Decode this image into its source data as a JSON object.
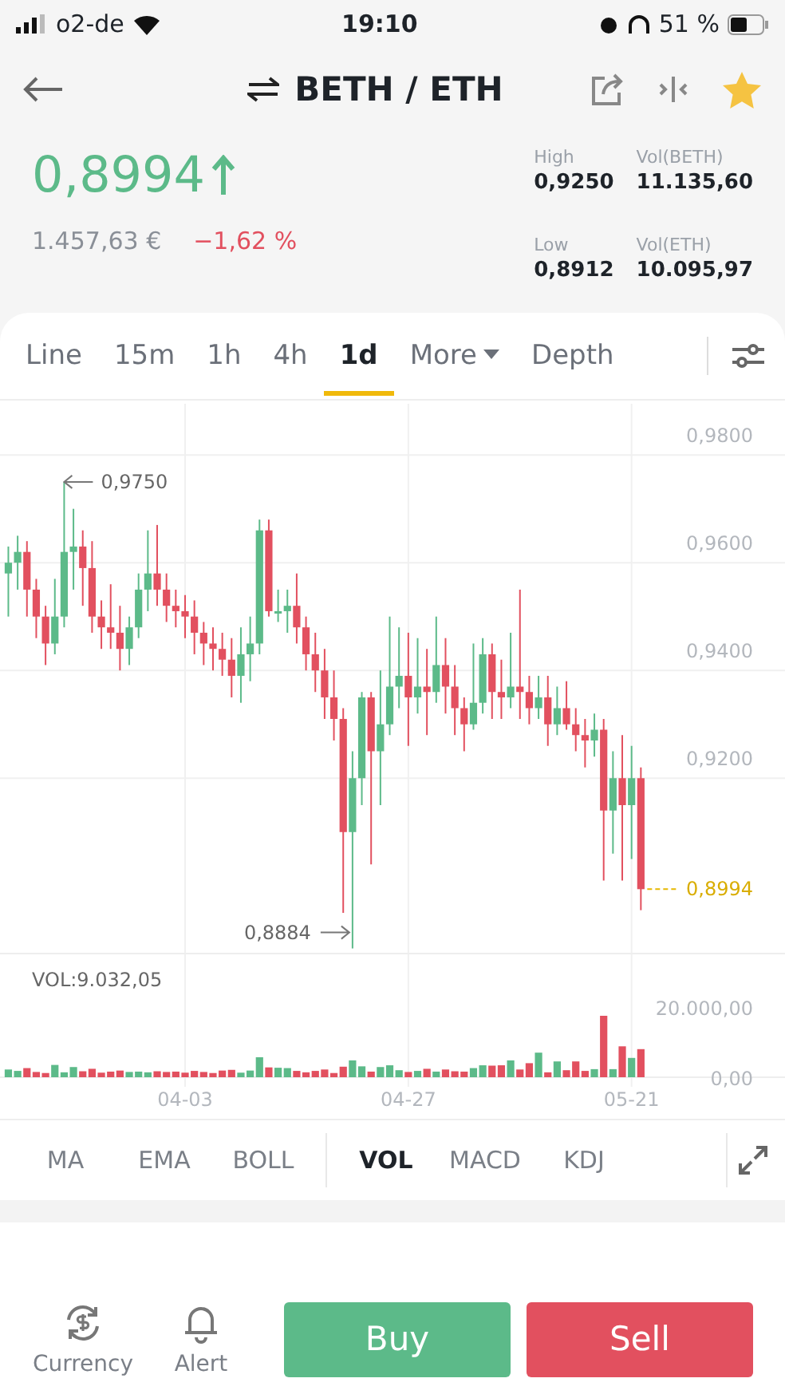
{
  "status_bar": {
    "carrier": "o2-de",
    "time": "19:10",
    "battery": "51 %"
  },
  "header": {
    "title": "BETH / ETH"
  },
  "ticker": {
    "price": "0,8994",
    "fiat_price": "1.457,63 €",
    "change": "−1,62 %",
    "stats": [
      {
        "label": "High",
        "value": "0,9250"
      },
      {
        "label": "Vol(BETH)",
        "value": "11.135,60"
      },
      {
        "label": "Low",
        "value": "0,8912"
      },
      {
        "label": "Vol(ETH)",
        "value": "10.095,97"
      }
    ]
  },
  "tabs": [
    {
      "label": "Line",
      "kind": "tab",
      "selected": false
    },
    {
      "label": "15m",
      "kind": "tab",
      "selected": false
    },
    {
      "label": "1h",
      "kind": "tab",
      "selected": false
    },
    {
      "label": "4h",
      "kind": "tab",
      "selected": false
    },
    {
      "label": "1d",
      "kind": "tab",
      "selected": true
    },
    {
      "label": "More",
      "kind": "menu",
      "selected": false
    },
    {
      "label": "Depth",
      "kind": "tab",
      "selected": false
    }
  ],
  "price_chart": {
    "high_mark": "0,9750",
    "low_mark": "0,8884",
    "last_price": "0,8994",
    "chart_data": {
      "type": "candlestick",
      "grid": true,
      "ohlc": [
        [
          0.958,
          0.963,
          0.95,
          0.96
        ],
        [
          0.96,
          0.965,
          0.955,
          0.962
        ],
        [
          0.962,
          0.964,
          0.95,
          0.955
        ],
        [
          0.955,
          0.957,
          0.946,
          0.95
        ],
        [
          0.95,
          0.952,
          0.941,
          0.945
        ],
        [
          0.945,
          0.957,
          0.943,
          0.95
        ],
        [
          0.95,
          0.975,
          0.948,
          0.962
        ],
        [
          0.962,
          0.97,
          0.955,
          0.963
        ],
        [
          0.963,
          0.966,
          0.952,
          0.959
        ],
        [
          0.959,
          0.964,
          0.947,
          0.95
        ],
        [
          0.95,
          0.953,
          0.944,
          0.948
        ],
        [
          0.948,
          0.956,
          0.944,
          0.947
        ],
        [
          0.947,
          0.952,
          0.94,
          0.944
        ],
        [
          0.944,
          0.95,
          0.941,
          0.948
        ],
        [
          0.948,
          0.958,
          0.946,
          0.955
        ],
        [
          0.955,
          0.966,
          0.951,
          0.958
        ],
        [
          0.958,
          0.967,
          0.952,
          0.955
        ],
        [
          0.955,
          0.958,
          0.949,
          0.952
        ],
        [
          0.952,
          0.955,
          0.948,
          0.951
        ],
        [
          0.951,
          0.954,
          0.946,
          0.95
        ],
        [
          0.95,
          0.953,
          0.943,
          0.947
        ],
        [
          0.947,
          0.949,
          0.941,
          0.945
        ],
        [
          0.945,
          0.948,
          0.94,
          0.944
        ],
        [
          0.944,
          0.947,
          0.939,
          0.942
        ],
        [
          0.942,
          0.946,
          0.935,
          0.939
        ],
        [
          0.939,
          0.948,
          0.934,
          0.943
        ],
        [
          0.943,
          0.95,
          0.938,
          0.945
        ],
        [
          0.945,
          0.968,
          0.943,
          0.966
        ],
        [
          0.966,
          0.968,
          0.95,
          0.951
        ],
        [
          0.951,
          0.955,
          0.949,
          0.951
        ],
        [
          0.951,
          0.955,
          0.947,
          0.952
        ],
        [
          0.952,
          0.958,
          0.945,
          0.948
        ],
        [
          0.948,
          0.95,
          0.94,
          0.943
        ],
        [
          0.943,
          0.947,
          0.936,
          0.94
        ],
        [
          0.94,
          0.944,
          0.931,
          0.935
        ],
        [
          0.935,
          0.94,
          0.927,
          0.931
        ],
        [
          0.931,
          0.933,
          0.895,
          0.91
        ],
        [
          0.91,
          0.925,
          0.8884,
          0.92
        ],
        [
          0.92,
          0.936,
          0.915,
          0.935
        ],
        [
          0.935,
          0.936,
          0.904,
          0.925
        ],
        [
          0.925,
          0.94,
          0.915,
          0.93
        ],
        [
          0.93,
          0.95,
          0.928,
          0.937
        ],
        [
          0.937,
          0.948,
          0.933,
          0.939
        ],
        [
          0.939,
          0.947,
          0.926,
          0.935
        ],
        [
          0.935,
          0.946,
          0.932,
          0.937
        ],
        [
          0.937,
          0.944,
          0.928,
          0.936
        ],
        [
          0.936,
          0.95,
          0.934,
          0.941
        ],
        [
          0.941,
          0.946,
          0.932,
          0.937
        ],
        [
          0.937,
          0.941,
          0.928,
          0.933
        ],
        [
          0.933,
          0.935,
          0.925,
          0.93
        ],
        [
          0.93,
          0.945,
          0.929,
          0.934
        ],
        [
          0.934,
          0.946,
          0.932,
          0.943
        ],
        [
          0.943,
          0.945,
          0.931,
          0.936
        ],
        [
          0.936,
          0.942,
          0.931,
          0.935
        ],
        [
          0.935,
          0.947,
          0.933,
          0.937
        ],
        [
          0.937,
          0.955,
          0.931,
          0.936
        ],
        [
          0.936,
          0.939,
          0.93,
          0.933
        ],
        [
          0.933,
          0.939,
          0.931,
          0.935
        ],
        [
          0.935,
          0.939,
          0.926,
          0.93
        ],
        [
          0.93,
          0.937,
          0.928,
          0.933
        ],
        [
          0.933,
          0.938,
          0.929,
          0.93
        ],
        [
          0.93,
          0.933,
          0.925,
          0.928
        ],
        [
          0.928,
          0.931,
          0.922,
          0.927
        ],
        [
          0.927,
          0.932,
          0.924,
          0.929
        ],
        [
          0.929,
          0.931,
          0.901,
          0.914
        ],
        [
          0.914,
          0.925,
          0.906,
          0.92
        ],
        [
          0.92,
          0.928,
          0.901,
          0.915
        ],
        [
          0.915,
          0.926,
          0.905,
          0.92
        ],
        [
          0.92,
          0.922,
          0.8955,
          0.8994
        ]
      ],
      "ylim": [
        0.8876,
        0.9895
      ],
      "yticks": [
        {
          "value": 0.98,
          "label": "0,9800"
        },
        {
          "value": 0.96,
          "label": "0,9600"
        },
        {
          "value": 0.94,
          "label": "0,9400"
        },
        {
          "value": 0.92,
          "label": "0,9200"
        }
      ]
    }
  },
  "volume_chart": {
    "chart_data": {
      "type": "bar",
      "title": "VOL:9.032,05",
      "grid": true,
      "categories": [
        null,
        null,
        null,
        null,
        null,
        null,
        null,
        null,
        null,
        null,
        null,
        null,
        null,
        null,
        null,
        null,
        null,
        null,
        null,
        "04-03",
        null,
        null,
        null,
        null,
        null,
        null,
        null,
        null,
        null,
        null,
        null,
        null,
        null,
        null,
        null,
        null,
        null,
        null,
        null,
        null,
        null,
        null,
        null,
        "04-27",
        null,
        null,
        null,
        null,
        null,
        null,
        null,
        null,
        null,
        null,
        null,
        null,
        null,
        null,
        null,
        null,
        null,
        null,
        null,
        null,
        null,
        null,
        null,
        "05-21",
        null
      ],
      "values": [
        2200,
        1800,
        2600,
        1500,
        1200,
        3500,
        1400,
        2900,
        1700,
        2400,
        1300,
        1600,
        1900,
        1500,
        1600,
        1400,
        1700,
        1500,
        1600,
        1300,
        1800,
        1500,
        1200,
        1900,
        2100,
        1300,
        1900,
        5700,
        2800,
        2700,
        2600,
        1800,
        1400,
        1800,
        2200,
        1200,
        3000,
        4800,
        3100,
        1600,
        2900,
        3400,
        2000,
        1500,
        1800,
        2400,
        1600,
        2200,
        1700,
        1600,
        2600,
        3400,
        3300,
        3400,
        4800,
        2200,
        4000,
        7000,
        1400,
        4500,
        2000,
        4500,
        1800,
        2300,
        17500,
        2300,
        8800,
        5500,
        8000
      ],
      "ylim": [
        0,
        20000
      ],
      "yticks": [
        {
          "value": 20000,
          "label": "20.000,00"
        },
        {
          "value": 0,
          "label": "0,00"
        }
      ]
    }
  },
  "indicators": {
    "main": [
      {
        "label": "MA",
        "selected": false
      },
      {
        "label": "EMA",
        "selected": false
      },
      {
        "label": "BOLL",
        "selected": false
      }
    ],
    "sub": [
      {
        "label": "VOL",
        "selected": true
      },
      {
        "label": "MACD",
        "selected": false
      },
      {
        "label": "KDJ",
        "selected": false
      }
    ]
  },
  "bottom_bar": {
    "actions": [
      {
        "label": "Currency",
        "kind": "currency"
      },
      {
        "label": "Alert",
        "kind": "alert"
      }
    ],
    "buy": "Buy",
    "sell": "Sell"
  }
}
